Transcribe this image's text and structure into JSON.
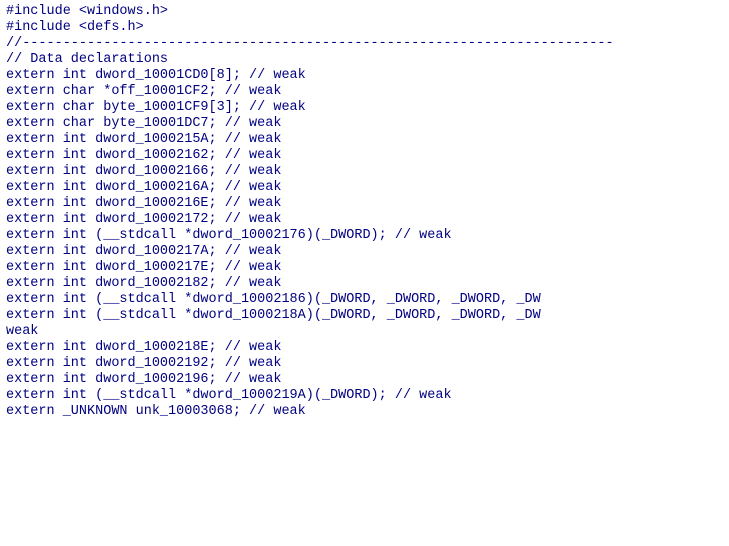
{
  "code": {
    "lines": [
      "#include <windows.h>",
      "#include <defs.h>",
      "",
      "",
      "//-------------------------------------------------------------------------",
      "// Data declarations",
      "",
      "extern int dword_10001CD0[8]; // weak",
      "extern char *off_10001CF2; // weak",
      "extern char byte_10001CF9[3]; // weak",
      "extern char byte_10001DC7; // weak",
      "extern int dword_1000215A; // weak",
      "extern int dword_10002162; // weak",
      "extern int dword_10002166; // weak",
      "extern int dword_1000216A; // weak",
      "extern int dword_1000216E; // weak",
      "extern int dword_10002172; // weak",
      "extern int (__stdcall *dword_10002176)(_DWORD); // weak",
      "extern int dword_1000217A; // weak",
      "extern int dword_1000217E; // weak",
      "extern int dword_10002182; // weak",
      "extern int (__stdcall *dword_10002186)(_DWORD, _DWORD, _DWORD, _DW",
      "extern int (__stdcall *dword_1000218A)(_DWORD, _DWORD, _DWORD, _DW",
      "weak",
      "extern int dword_1000218E; // weak",
      "extern int dword_10002192; // weak",
      "extern int dword_10002196; // weak",
      "extern int (__stdcall *dword_1000219A)(_DWORD); // weak",
      "extern _UNKNOWN unk_10003068; // weak"
    ]
  }
}
